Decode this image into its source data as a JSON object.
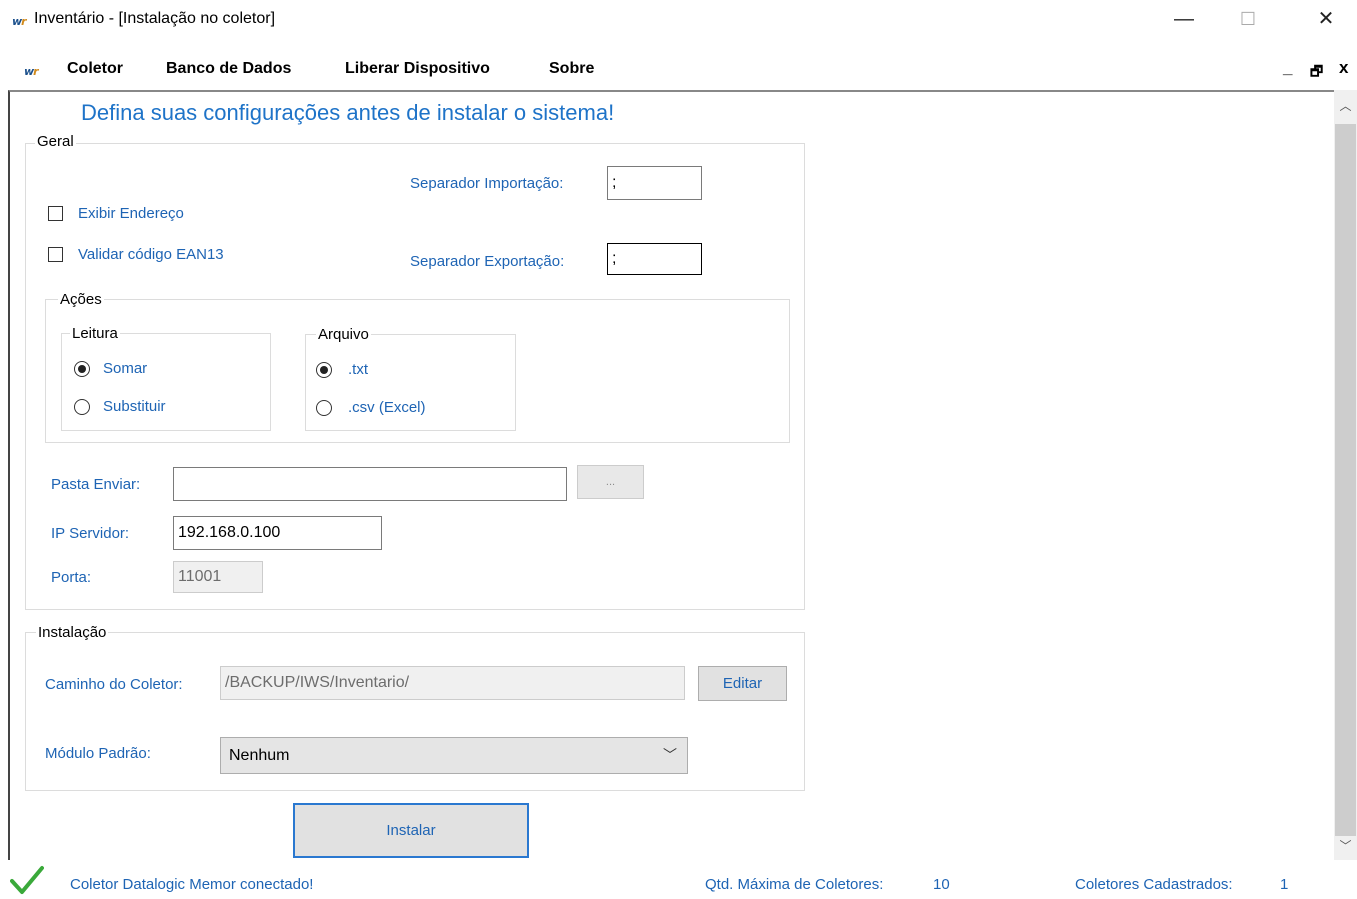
{
  "window": {
    "title": "Inventário - [Instalação no coletor]",
    "logo_text": "w",
    "controls": {
      "minimize": "—",
      "maximize": "☐",
      "close": "✕"
    }
  },
  "menu": {
    "items": [
      "Coletor",
      "Banco de Dados",
      "Liberar Dispositivo",
      "Sobre"
    ],
    "mdi_controls": {
      "minimize": "_",
      "restore": "🗗",
      "close": "x"
    }
  },
  "form": {
    "heading": "Defina suas configurações antes de instalar o sistema!",
    "geral": {
      "legend": "Geral",
      "exibir_endereco": {
        "label": "Exibir Endereço",
        "checked": false
      },
      "validar_ean13": {
        "label": "Validar código EAN13",
        "checked": false
      },
      "separador_importacao": {
        "label": "Separador Importação:",
        "value": ";"
      },
      "separador_exportacao": {
        "label": "Separador Exportação:",
        "value": ";"
      },
      "acoes": {
        "legend": "Ações",
        "leitura": {
          "legend": "Leitura",
          "options": [
            {
              "label": "Somar",
              "checked": true
            },
            {
              "label": "Substituir",
              "checked": false
            }
          ]
        },
        "arquivo": {
          "legend": "Arquivo",
          "options": [
            {
              "label": ".txt",
              "checked": true
            },
            {
              "label": ".csv (Excel)",
              "checked": false
            }
          ]
        }
      },
      "pasta_enviar": {
        "label": "Pasta Enviar:",
        "value": "",
        "browse_label": "..."
      },
      "ip_servidor": {
        "label": "IP Servidor:",
        "value": "192.168.0.100"
      },
      "porta": {
        "label": "Porta:",
        "value": "11001"
      }
    },
    "instalacao": {
      "legend": "Instalação",
      "caminho": {
        "label": "Caminho do Coletor:",
        "value": "/BACKUP/IWS/Inventario/",
        "edit_label": "Editar"
      },
      "modulo": {
        "label": "Módulo Padrão:",
        "selected": "Nenhum"
      }
    },
    "install_button": "Instalar"
  },
  "status": {
    "message": "Coletor Datalogic Memor conectado!",
    "max_label": "Qtd. Máxima de Coletores:",
    "max_value": "10",
    "registered_label": "Coletores Cadastrados:",
    "registered_value": "1"
  },
  "colors": {
    "accent": "#1e73c8",
    "label_blue": "#1e64b4",
    "success": "#3aa93a"
  }
}
